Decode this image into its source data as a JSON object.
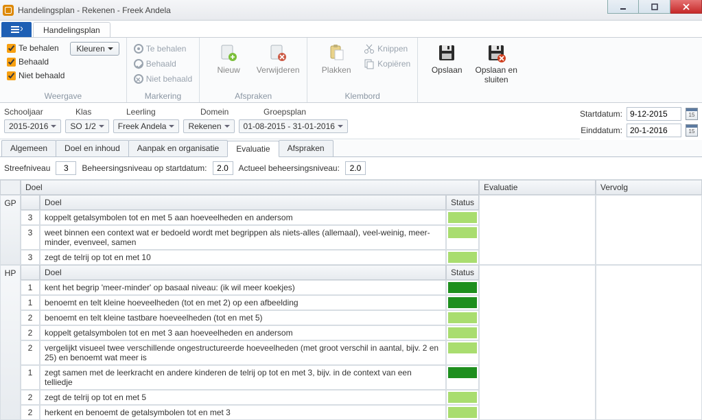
{
  "window": {
    "title": "Handelingsplan - Rekenen - Freek Andela"
  },
  "tabbar": {
    "main_tab": "Handelingsplan"
  },
  "ribbon": {
    "weergave": {
      "label": "Weergave",
      "te_behalen": "Te behalen",
      "behaald": "Behaald",
      "niet_behaald": "Niet behaald",
      "kleuren": "Kleuren"
    },
    "markering": {
      "label": "Markering",
      "te_behalen": "Te behalen",
      "behaald": "Behaald",
      "niet_behaald": "Niet behaald"
    },
    "afspraken": {
      "label": "Afspraken",
      "nieuw": "Nieuw",
      "verwijderen": "Verwijderen"
    },
    "klembord": {
      "label": "Klembord",
      "plakken": "Plakken",
      "knippen": "Knippen",
      "kopieren": "Kopiëren"
    },
    "opslaan": {
      "opslaan": "Opslaan",
      "opslaan_sluiten": "Opslaan en sluiten"
    }
  },
  "filters": {
    "schooljaar_label": "Schooljaar",
    "klas_label": "Klas",
    "leerling_label": "Leerling",
    "domein_label": "Domein",
    "groepsplan_label": "Groepsplan",
    "schooljaar": "2015-2016",
    "klas": "SO 1/2",
    "leerling": "Freek Andela",
    "domein": "Rekenen",
    "groepsplan": "01-08-2015 - 31-01-2016",
    "startdatum_label": "Startdatum:",
    "startdatum": "9-12-2015",
    "einddatum_label": "Einddatum:",
    "einddatum": "20-1-2016"
  },
  "subtabs": {
    "algemeen": "Algemeen",
    "doel_inhoud": "Doel en inhoud",
    "aanpak": "Aanpak en organisatie",
    "evaluatie": "Evaluatie",
    "afspraken": "Afspraken"
  },
  "streef": {
    "label": "Streefniveau",
    "niveau": "3",
    "start_label": "Beheersingsniveau op startdatum:",
    "start_val": "2.0",
    "actueel_label": "Actueel beheersingsniveau:",
    "actueel_val": "2.0"
  },
  "grid": {
    "col_doel": "Doel",
    "col_evaluatie": "Evaluatie",
    "col_vervolg": "Vervolg",
    "col_status": "Status",
    "sections": [
      {
        "side": "GP",
        "rows": [
          {
            "n": "3",
            "doel": "koppelt getalsymbolen tot en met 5 aan hoeveelheden en andersom",
            "status_color": "c-lightgreen"
          },
          {
            "n": "3",
            "doel": "weet binnen een context wat er bedoeld wordt met begrippen als niets-alles (allemaal), veel-weinig, meer-minder, evenveel, samen",
            "status_color": "c-lightgreen"
          },
          {
            "n": "3",
            "doel": "zegt de telrij op tot en met 10",
            "status_color": "c-lightgreen"
          }
        ]
      },
      {
        "side": "HP",
        "rows": [
          {
            "n": "1",
            "doel": "kent het begrip 'meer-minder' op basaal niveau: (ik wil meer koekjes)",
            "status_color": "c-green"
          },
          {
            "n": "1",
            "doel": "benoemt en telt kleine hoeveelheden (tot en met 2) op een afbeelding",
            "status_color": "c-green"
          },
          {
            "n": "2",
            "doel": "benoemt en telt kleine tastbare hoeveelheden (tot en met 5)",
            "status_color": "c-lightgreen"
          },
          {
            "n": "2",
            "doel": "koppelt getalsymbolen tot en met 3 aan hoeveelheden en andersom",
            "status_color": "c-lightgreen"
          },
          {
            "n": "2",
            "doel": "vergelijkt visueel twee verschillende ongestructureerde hoeveelheden (met groot verschil in aantal, bijv. 2 en 25) en benoemt wat meer is",
            "status_color": "c-lightgreen"
          },
          {
            "n": "1",
            "doel": "zegt samen met de leerkracht en andere kinderen de telrij op tot en met 3, bijv. in de context van een telliedje",
            "status_color": "c-green"
          },
          {
            "n": "2",
            "doel": "zegt de telrij op tot en met 5",
            "status_color": "c-lightgreen"
          },
          {
            "n": "2",
            "doel": "herkent en benoemt de getalsymbolen tot en met 3",
            "status_color": "c-lightgreen"
          }
        ]
      }
    ]
  }
}
